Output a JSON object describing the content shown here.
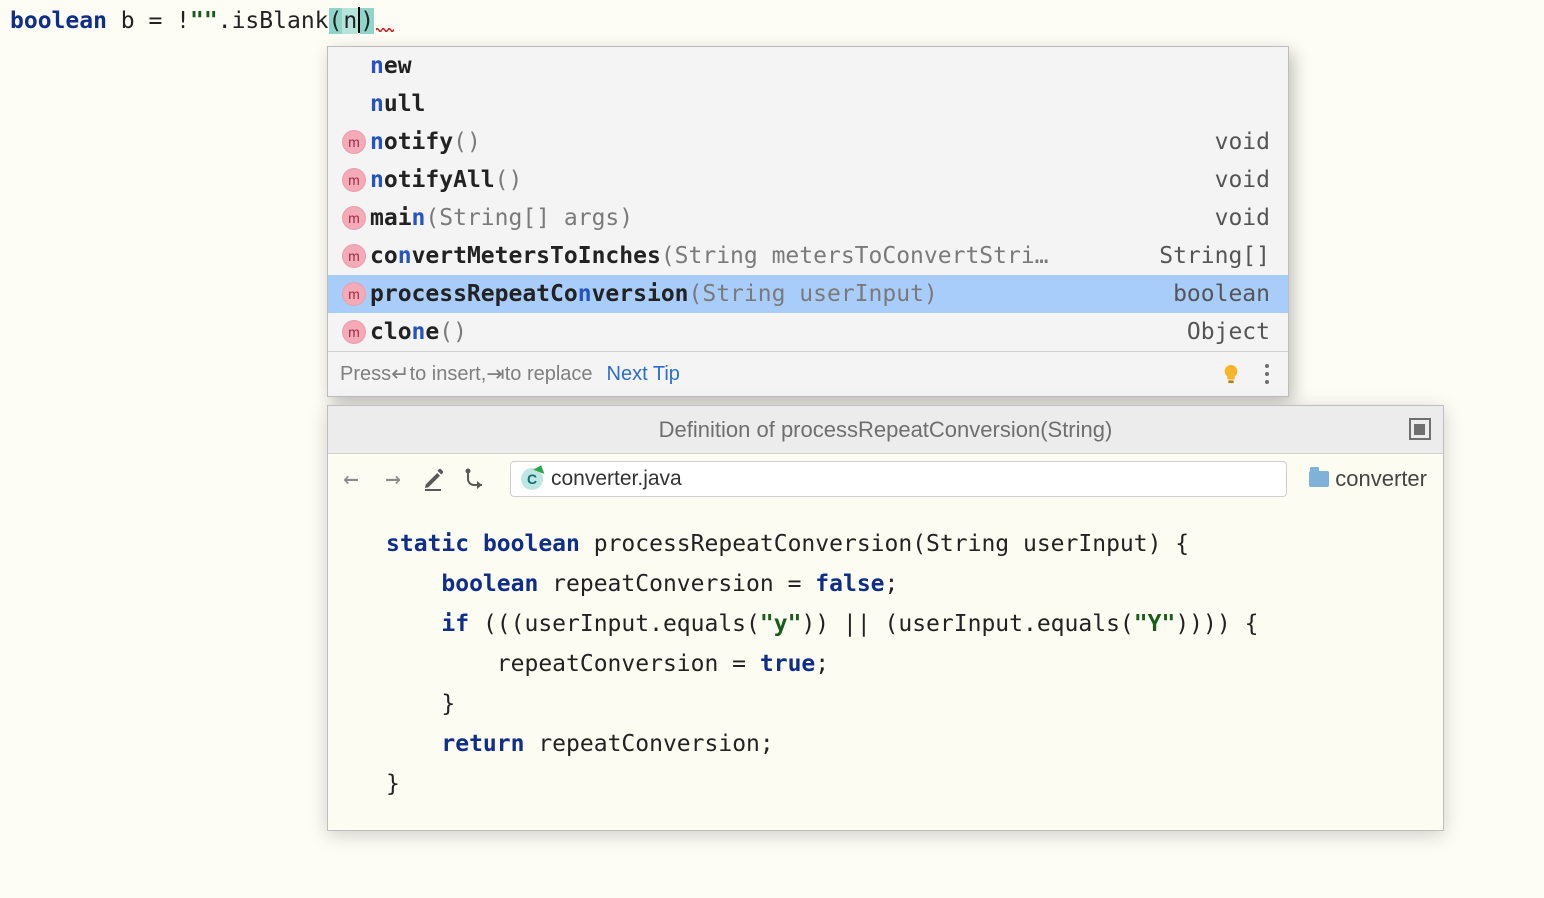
{
  "code_line": {
    "kw": "boolean",
    "var": " b = !",
    "str": "\"\"",
    "method": ".isBlank",
    "open": "(",
    "typed": "n",
    "close": ")"
  },
  "completion": {
    "items": [
      {
        "icon": "",
        "prefix": "",
        "bold": "n",
        "rest": "ew",
        "params": "",
        "ret": "",
        "selected": false
      },
      {
        "icon": "",
        "prefix": "",
        "bold": "n",
        "rest": "ull",
        "params": "",
        "ret": "",
        "selected": false
      },
      {
        "icon": "m",
        "prefix": "",
        "bold": "n",
        "rest": "otify",
        "params": "()",
        "ret": "void",
        "selected": false
      },
      {
        "icon": "m",
        "prefix": "",
        "bold": "n",
        "rest": "otifyAll",
        "params": "()",
        "ret": "void",
        "selected": false
      },
      {
        "icon": "m",
        "prefix": "mai",
        "bold": "n",
        "rest": "",
        "params": "(String[] args)",
        "ret": "void",
        "selected": false
      },
      {
        "icon": "m",
        "prefix": "co",
        "bold": "n",
        "rest": "vertMetersToInches",
        "params": "(String metersToConvertStri…",
        "ret": "String[]",
        "selected": false
      },
      {
        "icon": "m",
        "prefix": "processRepeatCo",
        "bold": "n",
        "rest": "version",
        "params": "(String userInput)",
        "ret": "boolean",
        "selected": true
      },
      {
        "icon": "m",
        "prefix": "clo",
        "bold": "n",
        "rest": "e",
        "params": "()",
        "ret": "Object",
        "selected": false
      }
    ],
    "footer_press": "Press ",
    "footer_insert": " to insert, ",
    "footer_replace": " to replace",
    "next_tip": "Next Tip"
  },
  "definition": {
    "title": "Definition of processRepeatConversion(String)",
    "filename": "converter.java",
    "package": "converter",
    "code_tokens": [
      {
        "t": "ck",
        "v": "static "
      },
      {
        "t": "ck",
        "v": "boolean "
      },
      {
        "t": "cid",
        "v": "processRepeatConversion(String userInput) {\n"
      },
      {
        "t": "cid",
        "v": "    "
      },
      {
        "t": "ck",
        "v": "boolean "
      },
      {
        "t": "cid",
        "v": "repeatConversion = "
      },
      {
        "t": "ck",
        "v": "false"
      },
      {
        "t": "cid",
        "v": ";\n"
      },
      {
        "t": "cid",
        "v": "    "
      },
      {
        "t": "ck",
        "v": "if "
      },
      {
        "t": "cid",
        "v": "(((userInput.equals("
      },
      {
        "t": "cstr",
        "v": "\"y\""
      },
      {
        "t": "cid",
        "v": ")) || (userInput.equals("
      },
      {
        "t": "cstr",
        "v": "\"Y\""
      },
      {
        "t": "cid",
        "v": ")))) {\n"
      },
      {
        "t": "cid",
        "v": "        repeatConversion = "
      },
      {
        "t": "ck",
        "v": "true"
      },
      {
        "t": "cid",
        "v": ";\n"
      },
      {
        "t": "cid",
        "v": "    }\n"
      },
      {
        "t": "cid",
        "v": "    "
      },
      {
        "t": "ck",
        "v": "return "
      },
      {
        "t": "cid",
        "v": "repeatConversion;\n"
      },
      {
        "t": "cid",
        "v": "}"
      }
    ]
  }
}
